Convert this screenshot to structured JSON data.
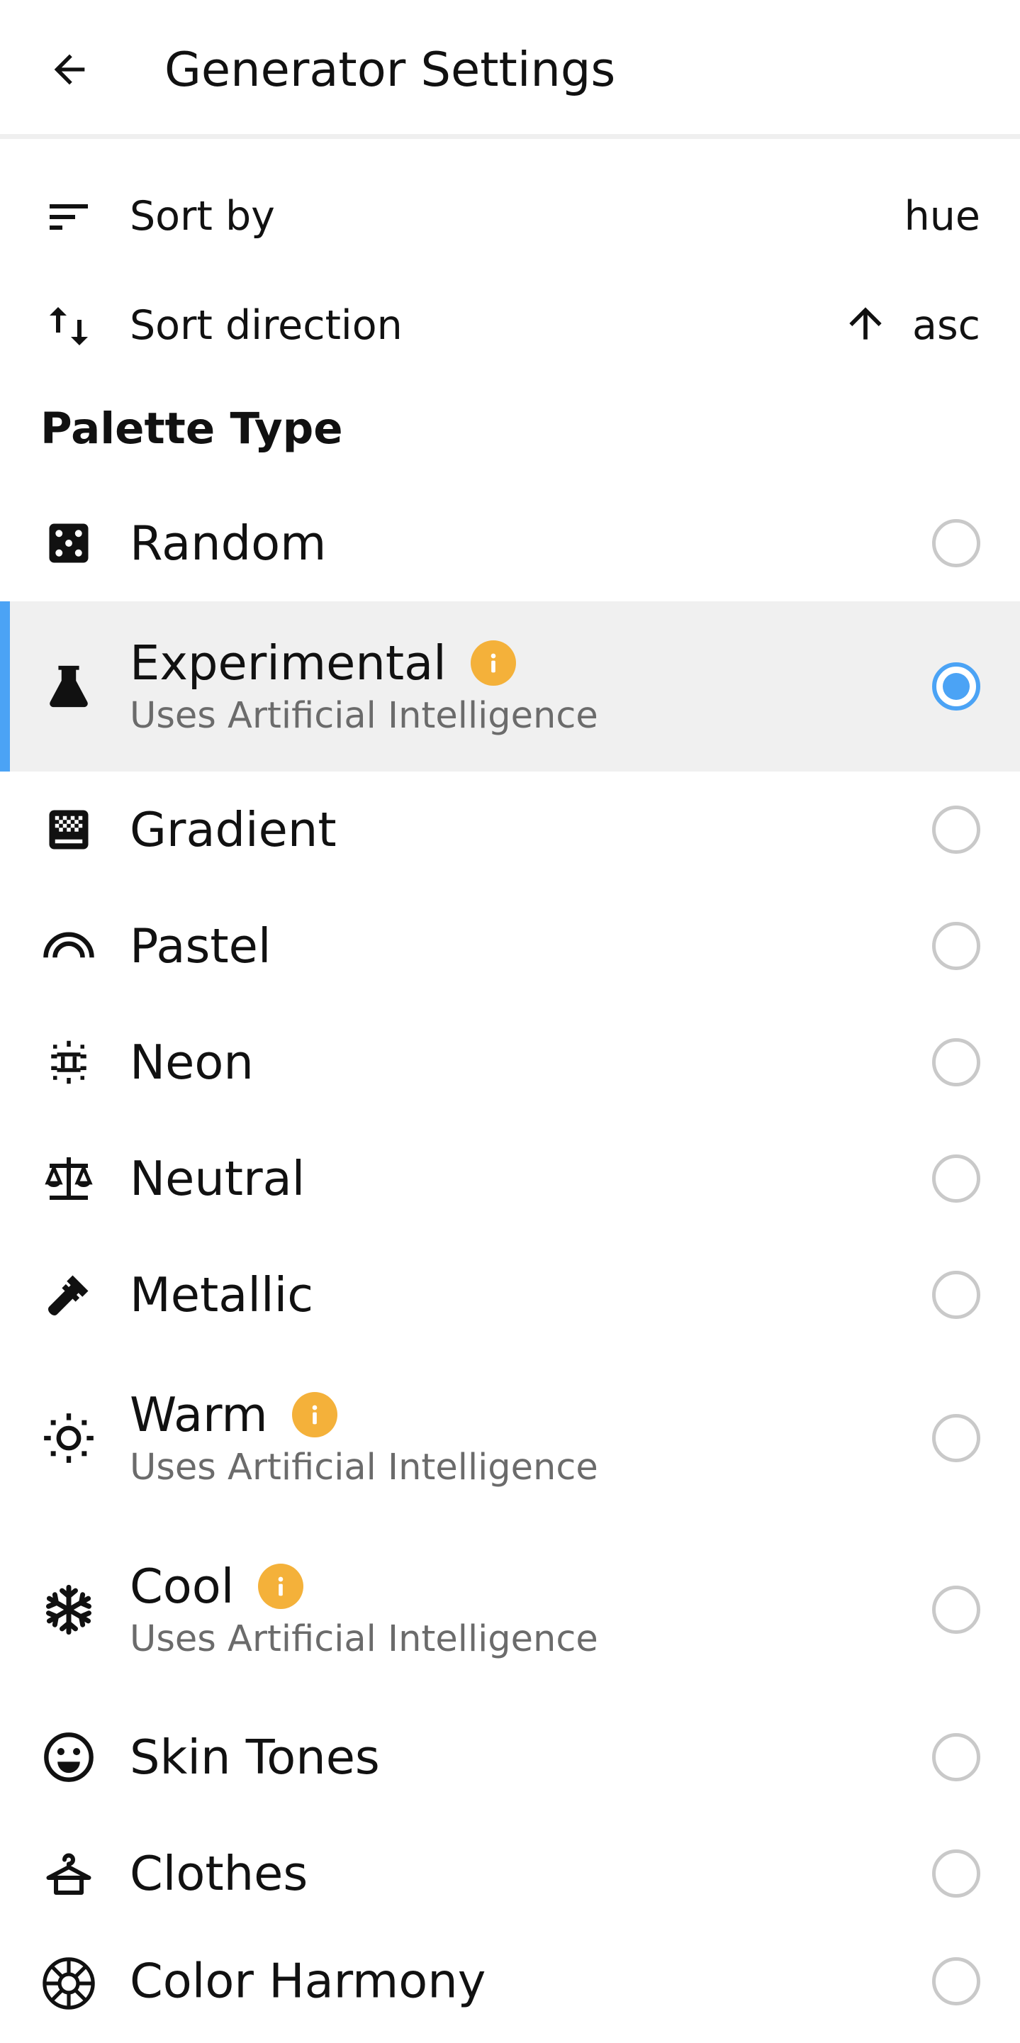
{
  "appbar": {
    "title": "Generator Settings"
  },
  "sort": {
    "sort_by_label": "Sort by",
    "sort_by_value": "hue",
    "direction_label": "Sort direction",
    "direction_value": "asc"
  },
  "palette_type": {
    "header": "Palette Type",
    "selected": "Experimental",
    "items": [
      {
        "label": "Random",
        "icon": "dice-icon",
        "ai": false,
        "selected": false
      },
      {
        "label": "Experimental",
        "icon": "flask-icon",
        "ai": true,
        "subtitle": "Uses Artificial Intelligence",
        "selected": true
      },
      {
        "label": "Gradient",
        "icon": "gradient-icon",
        "ai": false,
        "selected": false
      },
      {
        "label": "Pastel",
        "icon": "rainbow-icon",
        "ai": false,
        "selected": false
      },
      {
        "label": "Neon",
        "icon": "neon-sign-icon",
        "ai": false,
        "selected": false
      },
      {
        "label": "Neutral",
        "icon": "scale-balance-icon",
        "ai": false,
        "selected": false
      },
      {
        "label": "Metallic",
        "icon": "pipe-wrench-icon",
        "ai": false,
        "selected": false
      },
      {
        "label": "Warm",
        "icon": "sun-icon",
        "ai": true,
        "subtitle": "Uses Artificial Intelligence",
        "selected": false
      },
      {
        "label": "Cool",
        "icon": "snowflake-icon",
        "ai": true,
        "subtitle": "Uses Artificial Intelligence",
        "selected": false
      },
      {
        "label": "Skin Tones",
        "icon": "smiley-face-icon",
        "ai": false,
        "selected": false
      },
      {
        "label": "Clothes",
        "icon": "hanger-icon",
        "ai": false,
        "selected": false
      },
      {
        "label": "Color Harmony",
        "icon": "color-wheel-icon",
        "ai": false,
        "selected": false
      }
    ]
  },
  "colors": {
    "accent": "#4ba3f5",
    "info_badge": "#f4b13a",
    "selected_row_bg": "#f0f0f0",
    "subtitle_text": "#6b6b6b"
  }
}
